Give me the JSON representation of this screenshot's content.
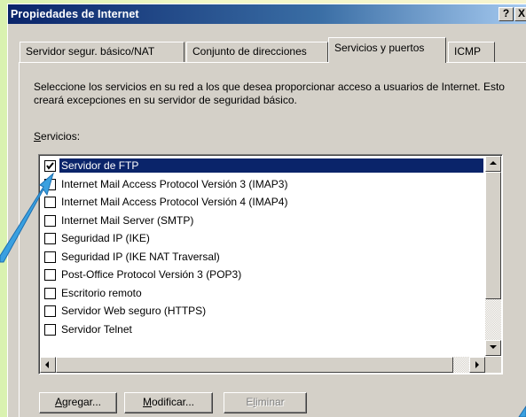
{
  "window": {
    "title": "Propiedades de Internet",
    "help_label": "?",
    "close_label": "X"
  },
  "tabs": [
    {
      "label": "Servidor segur. básico/NAT",
      "active": false
    },
    {
      "label": "Conjunto de direcciones",
      "active": false
    },
    {
      "label": "Servicios y puertos",
      "active": true
    },
    {
      "label": "ICMP",
      "active": false
    }
  ],
  "panel": {
    "description": "Seleccione los servicios en su red a los que desea proporcionar acceso a usuarios de Internet.  Esto creará excepciones en su servidor de seguridad básico.",
    "services_label_prefix": "S",
    "services_label_rest": "ervicios:"
  },
  "services": [
    {
      "label": "Servidor de FTP",
      "checked": true,
      "selected": true
    },
    {
      "label": "Internet Mail Access Protocol Versión 3 (IMAP3)",
      "checked": false,
      "selected": false
    },
    {
      "label": "Internet Mail Access Protocol Versión 4 (IMAP4)",
      "checked": false,
      "selected": false
    },
    {
      "label": "Internet Mail Server (SMTP)",
      "checked": false,
      "selected": false
    },
    {
      "label": "Seguridad IP (IKE)",
      "checked": false,
      "selected": false
    },
    {
      "label": "Seguridad IP (IKE NAT Traversal)",
      "checked": false,
      "selected": false
    },
    {
      "label": "Post-Office Protocol Versión 3 (POP3)",
      "checked": false,
      "selected": false
    },
    {
      "label": "Escritorio remoto",
      "checked": false,
      "selected": false
    },
    {
      "label": "Servidor Web seguro (HTTPS)",
      "checked": false,
      "selected": false
    },
    {
      "label": "Servidor Telnet",
      "checked": false,
      "selected": false
    }
  ],
  "buttons": {
    "add_prefix": "A",
    "add_rest": "gregar...",
    "modify_prefix": "M",
    "modify_rest": "odificar...",
    "delete_pre": "E",
    "delete_accel": "l",
    "delete_rest": "iminar"
  },
  "colors": {
    "selection": "#0a246a",
    "annotation_arrow": "#3aa0e0"
  }
}
